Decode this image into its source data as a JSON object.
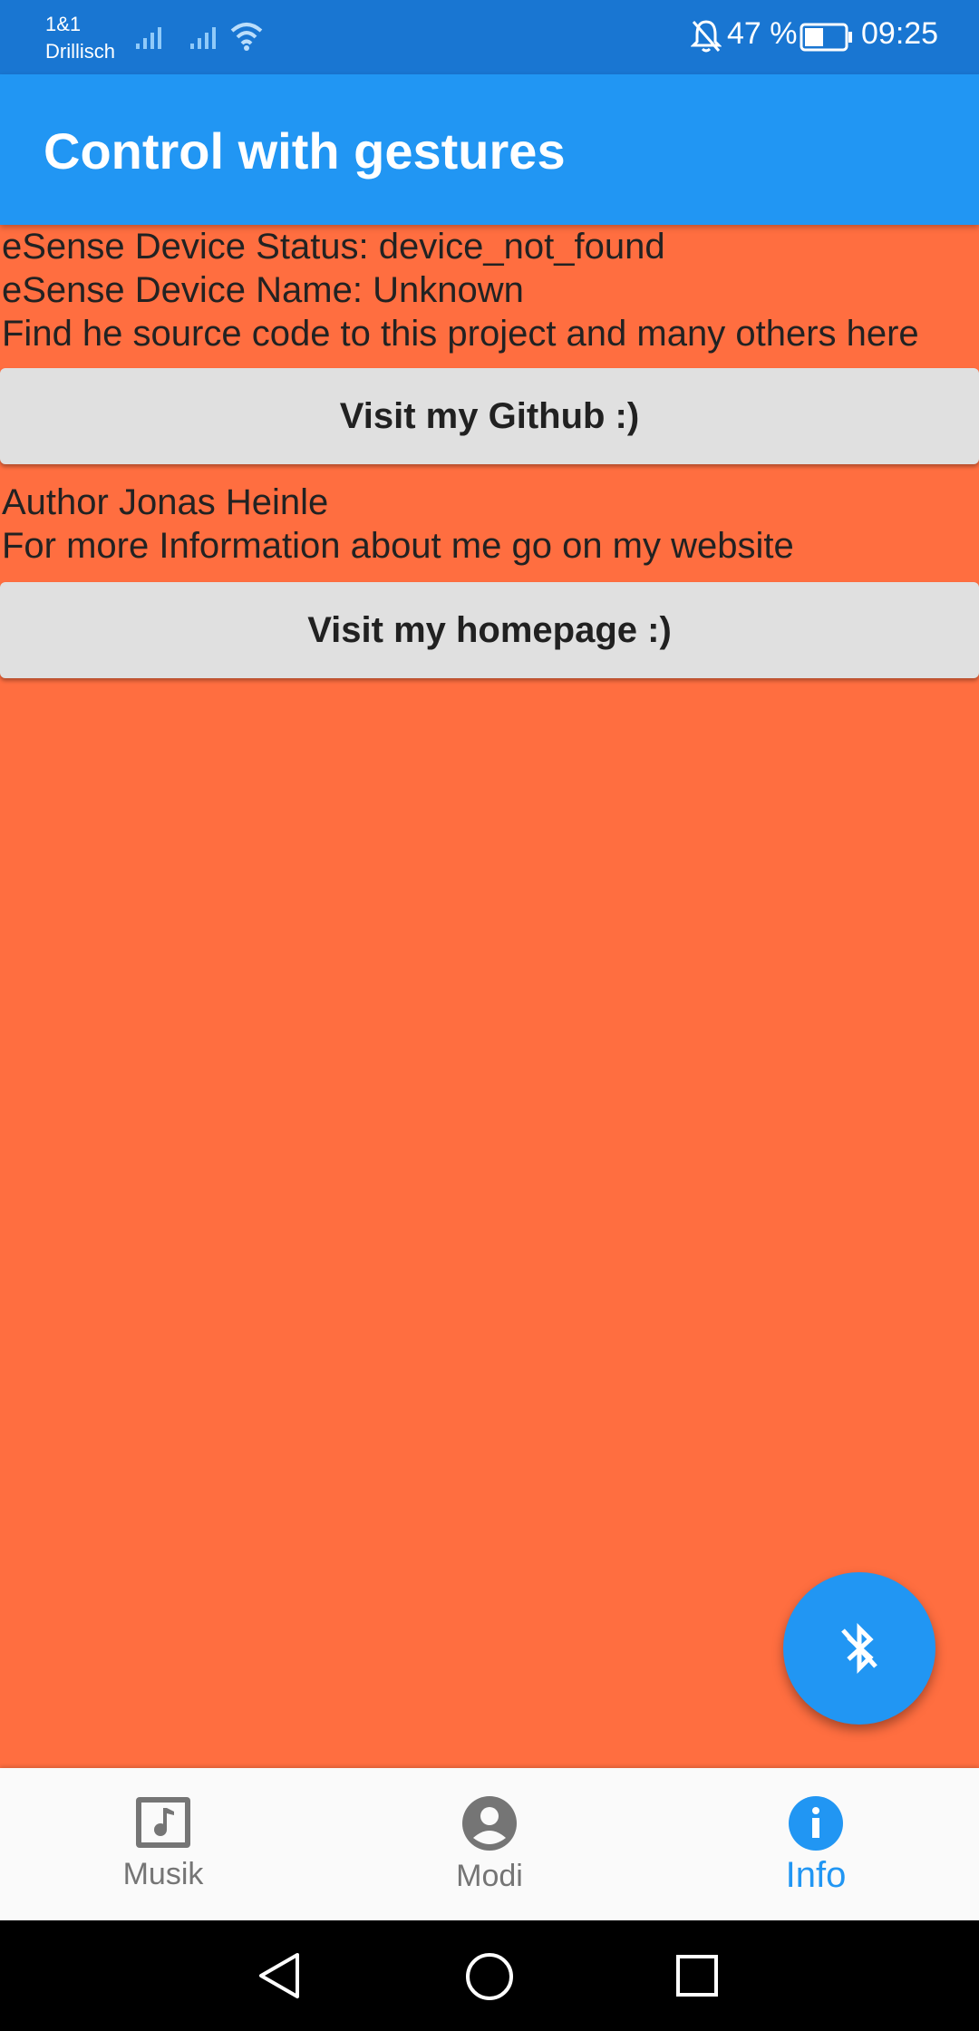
{
  "status_bar": {
    "carrier_line1": "1&1",
    "carrier_line2": "Drillisch",
    "battery_percent": "47 %",
    "battery_level": 0.47,
    "time": "09:25",
    "icons": [
      "signal-icon",
      "signal-icon",
      "wifi-icon",
      "bell-off-icon",
      "battery-icon"
    ]
  },
  "app_bar": {
    "title": "Control with gestures"
  },
  "content": {
    "device_status": "eSense Device Status:  device_not_found",
    "device_name": "eSense Device Name:  Unknown",
    "source_text": "Find he source code to this project and many others here",
    "github_button": "Visit my Github :)",
    "author_text": "Author Jonas Heinle",
    "info_text": "For more Information about me go on my website",
    "homepage_button": "Visit my homepage :)"
  },
  "fab": {
    "icon": "bluetooth-disabled-icon"
  },
  "bottom_nav": {
    "items": [
      {
        "label": "Musik",
        "icon": "music-note-icon",
        "active": false
      },
      {
        "label": "Modi",
        "icon": "account-circle-icon",
        "active": false
      },
      {
        "label": "Info",
        "icon": "info-icon",
        "active": true
      }
    ]
  },
  "colors": {
    "status_bar": "#1976d2",
    "app_bar": "#2196f3",
    "background": "#ff6e40",
    "button": "#e0e0e0",
    "accent": "#2196f3",
    "nav_inactive": "#757575"
  }
}
